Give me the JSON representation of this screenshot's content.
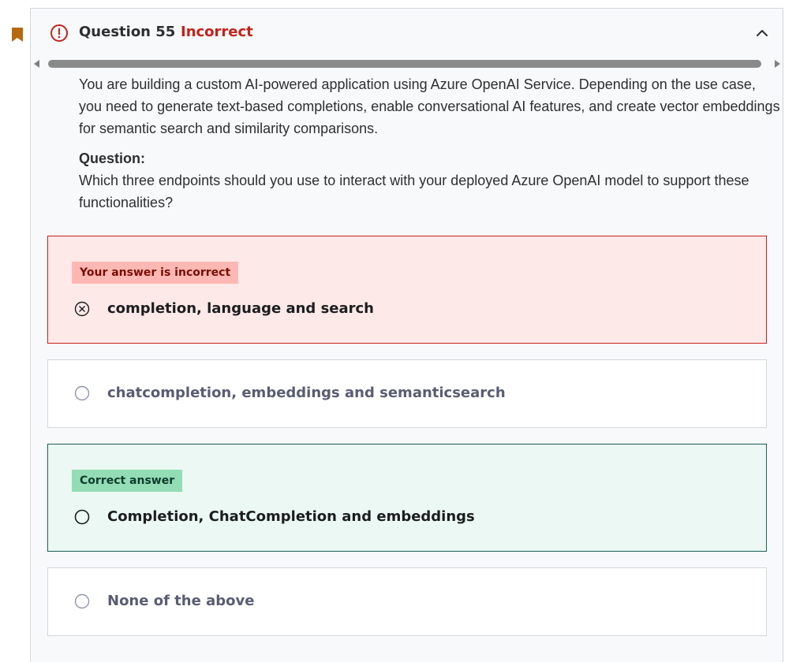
{
  "question": {
    "title": "Question 55",
    "status": "Incorrect",
    "status_color": "#c4221b",
    "icons": {
      "status": "alert-circle-icon",
      "toggle": "chevron-up-icon",
      "bookmark": "bookmark-icon"
    },
    "prompt": {
      "intro": "You are building a custom AI-powered application using Azure OpenAI Service. Depending on the use case, you need to generate text-based completions, enable conversational AI features, and create vector embeddings for semantic search and similarity comparisons.",
      "question_label": "Question:",
      "question_text": "Which three endpoints should you use to interact with your deployed Azure OpenAI model to support these functionalities?"
    }
  },
  "options": [
    {
      "badge": "Your answer is incorrect",
      "label": "completion, language and search",
      "state": "selected-incorrect",
      "icon": "x-circle-icon"
    },
    {
      "label": "chatcompletion, embeddings and semanticsearch",
      "state": "unselected",
      "icon": "radio-empty-icon"
    },
    {
      "badge": "Correct answer",
      "label": "Completion, ChatCompletion and embeddings",
      "state": "correct",
      "icon": "radio-empty-icon"
    },
    {
      "label": "None of the above",
      "state": "unselected",
      "icon": "radio-empty-icon"
    }
  ],
  "colors": {
    "incorrect_border": "#c4221b",
    "incorrect_bg": "#fde9e8",
    "correct_border": "#1e6055",
    "correct_bg": "#ebf8f3",
    "bookmark": "#b4690e"
  }
}
